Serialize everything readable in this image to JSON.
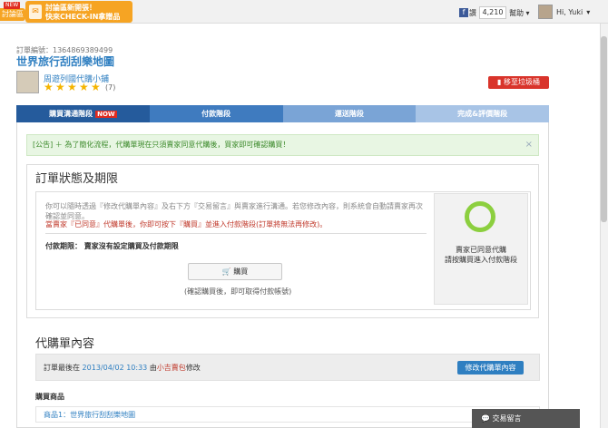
{
  "topbar": {
    "new_badge": "NEW",
    "logo_text": "討論區",
    "promo": {
      "line1": "討論區新開張！",
      "line2": "快來CHECK-IN拿贈品"
    },
    "fb_label": "讚",
    "fb_count": "4,210",
    "help": "幫助",
    "user_name": "Hi, Yuki"
  },
  "order": {
    "number": "訂單編號：1364869389499",
    "title": "世界旅行刮刮樂地圖",
    "shop": "周遊列國代購小鋪",
    "rating_count": "(7)",
    "trash_button": "移至垃圾桶"
  },
  "steps": [
    {
      "label": "購買溝通階段",
      "badge": "NOW"
    },
    {
      "label": "付款階段"
    },
    {
      "label": "運送階段"
    },
    {
      "label": "完成&評價階段"
    }
  ],
  "notice": {
    "text": "[公告] ＋ 為了簡化流程，代購單現在只須賣家同意代購後，買家即可確認購買！",
    "close": "×"
  },
  "status": {
    "title": "訂單狀態及期限",
    "desc": "你可以隨時透過『修改代購單內容』及右下方『交易留言』與賣家進行溝通。若您修改內容，則系統會自動請賣家再次確認並同意。",
    "warn": "當賣家『已同意』代購單後，你即可按下『購買』並進入付款階段(訂單將無法再修改)。",
    "deadline": "付款期限： 賣家沒有設定購買及付款期限",
    "buy_button": "購買",
    "buy_note": "(確認購買後，即可取得付款帳號)",
    "side_text_line1": "賣家已同意代購",
    "side_text_line2": "請按購買進入付款階段"
  },
  "content": {
    "title": "代購單內容",
    "update_prefix": "訂單最後在",
    "update_datetime": "2013/04/02 10:33",
    "update_by": "由",
    "update_user": "小吉賣包",
    "update_suffix": "修改",
    "edit_button": "修改代購單內容",
    "items_label": "購買商品",
    "item": "商品1：世界旅行刮刮樂地圖"
  },
  "msg_tab": "交易留言",
  "colors": {
    "primary_blue": "#2f7fc1",
    "danger_red": "#d9342b",
    "accent_orange": "#f6a423",
    "success_green": "#8ccf3f"
  }
}
